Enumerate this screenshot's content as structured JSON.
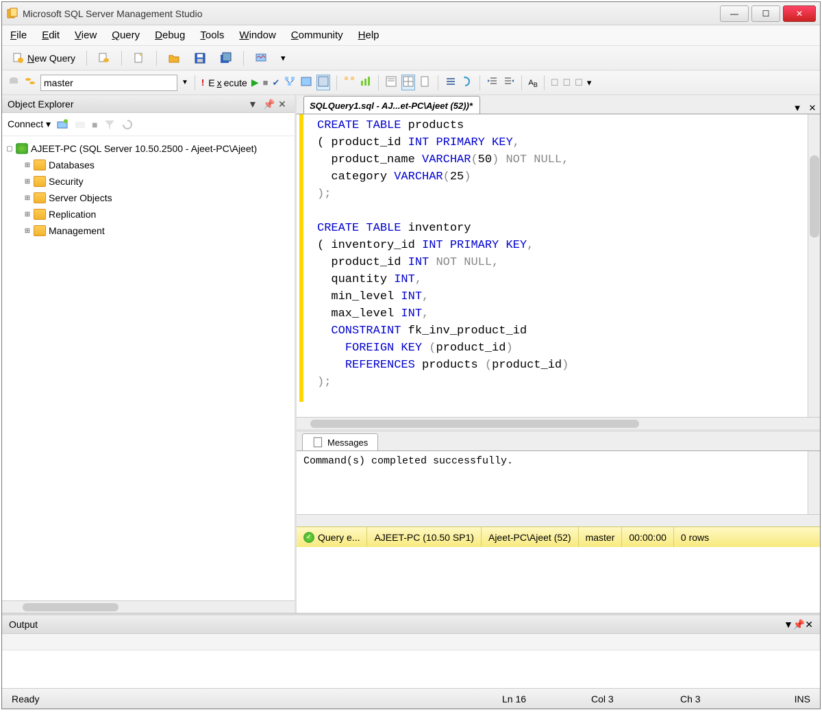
{
  "title": "Microsoft SQL Server Management Studio",
  "menu": [
    "File",
    "Edit",
    "View",
    "Query",
    "Debug",
    "Tools",
    "Window",
    "Community",
    "Help"
  ],
  "toolbar1": {
    "new_query": "New Query"
  },
  "dbbar": {
    "database": "master",
    "execute": "Execute"
  },
  "object_explorer": {
    "title": "Object Explorer",
    "connect": "Connect",
    "root": "AJEET-PC (SQL Server 10.50.2500 - Ajeet-PC\\Ajeet)",
    "children": [
      "Databases",
      "Security",
      "Server Objects",
      "Replication",
      "Management"
    ]
  },
  "editor": {
    "tab": "SQLQuery1.sql - AJ...et-PC\\Ajeet (52))*",
    "sql_lines": [
      [
        [
          "kw",
          "CREATE TABLE"
        ],
        [
          "",
          " products"
        ]
      ],
      [
        [
          "",
          "( product_id "
        ],
        [
          "dt",
          "INT"
        ],
        [
          "",
          " "
        ],
        [
          "kw",
          "PRIMARY KEY"
        ],
        [
          "gr",
          ","
        ]
      ],
      [
        [
          "",
          "  product_name "
        ],
        [
          "dt",
          "VARCHAR"
        ],
        [
          "gr",
          "("
        ],
        [
          "",
          "50"
        ],
        [
          "gr",
          ")"
        ],
        [
          "",
          " "
        ],
        [
          "gr",
          "NOT NULL,"
        ]
      ],
      [
        [
          "",
          "  category "
        ],
        [
          "dt",
          "VARCHAR"
        ],
        [
          "gr",
          "("
        ],
        [
          "",
          "25"
        ],
        [
          "gr",
          ")"
        ]
      ],
      [
        [
          "gr",
          ");"
        ]
      ],
      [
        [
          "",
          ""
        ]
      ],
      [
        [
          "kw",
          "CREATE TABLE"
        ],
        [
          "",
          " inventory"
        ]
      ],
      [
        [
          "",
          "( inventory_id "
        ],
        [
          "dt",
          "INT"
        ],
        [
          "",
          " "
        ],
        [
          "kw",
          "PRIMARY KEY"
        ],
        [
          "gr",
          ","
        ]
      ],
      [
        [
          "",
          "  product_id "
        ],
        [
          "dt",
          "INT"
        ],
        [
          "",
          " "
        ],
        [
          "gr",
          "NOT NULL,"
        ]
      ],
      [
        [
          "",
          "  quantity "
        ],
        [
          "dt",
          "INT"
        ],
        [
          "gr",
          ","
        ]
      ],
      [
        [
          "",
          "  min_level "
        ],
        [
          "dt",
          "INT"
        ],
        [
          "gr",
          ","
        ]
      ],
      [
        [
          "",
          "  max_level "
        ],
        [
          "dt",
          "INT"
        ],
        [
          "gr",
          ","
        ]
      ],
      [
        [
          "",
          "  "
        ],
        [
          "kw",
          "CONSTRAINT"
        ],
        [
          "",
          " fk_inv_product_id"
        ]
      ],
      [
        [
          "",
          "    "
        ],
        [
          "kw",
          "FOREIGN KEY"
        ],
        [
          "",
          " "
        ],
        [
          "gr",
          "("
        ],
        [
          "",
          "product_id"
        ],
        [
          "gr",
          ")"
        ]
      ],
      [
        [
          "",
          "    "
        ],
        [
          "kw",
          "REFERENCES"
        ],
        [
          "",
          " products "
        ],
        [
          "gr",
          "("
        ],
        [
          "",
          "product_id"
        ],
        [
          "gr",
          ")"
        ]
      ],
      [
        [
          "gr",
          ");"
        ]
      ]
    ]
  },
  "messages": {
    "tab": "Messages",
    "text": "Command(s) completed successfully."
  },
  "query_status": {
    "label": "Query e...",
    "server": "AJEET-PC (10.50 SP1)",
    "login": "Ajeet-PC\\Ajeet (52)",
    "db": "master",
    "time": "00:00:00",
    "rows": "0 rows"
  },
  "output": {
    "title": "Output"
  },
  "statusbar": {
    "ready": "Ready",
    "ln": "Ln 16",
    "col": "Col 3",
    "ch": "Ch 3",
    "ins": "INS"
  }
}
